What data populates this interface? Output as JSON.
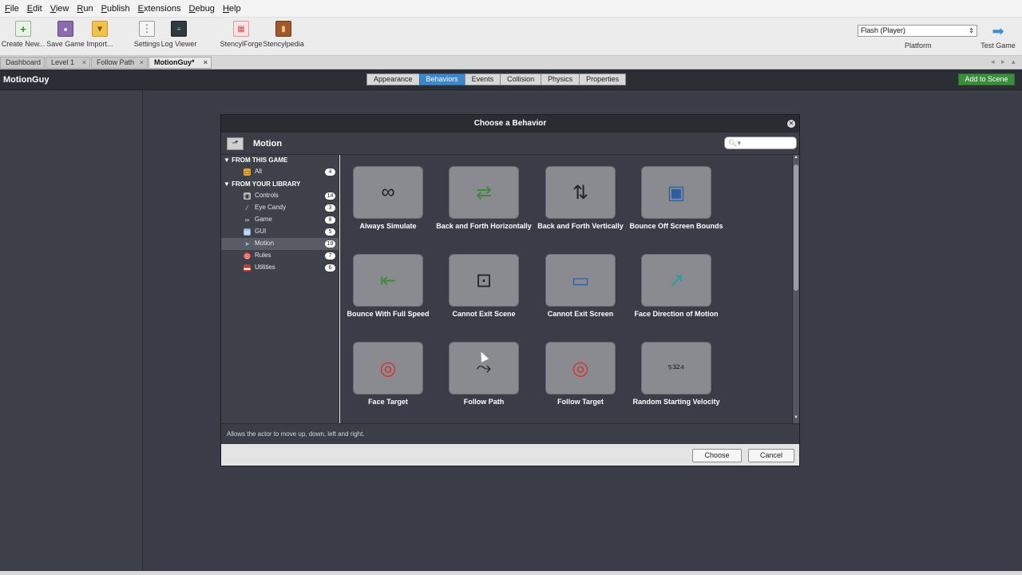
{
  "menu": [
    "File",
    "Edit",
    "View",
    "Run",
    "Publish",
    "Extensions",
    "Debug",
    "Help"
  ],
  "toolbar": {
    "create_new": "Create New...",
    "save_game": "Save Game",
    "import": "Import...",
    "settings": "Settings",
    "log_viewer": "Log Viewer",
    "stencylforge": "StencylForge",
    "stencylpedia": "Stencylpedia",
    "platform_value": "Flash (Player)",
    "platform_label": "Platform",
    "test_game": "Test Game"
  },
  "tabs": [
    {
      "label": "Dashboard"
    },
    {
      "label": "Level 1"
    },
    {
      "label": "Follow Path"
    },
    {
      "label": "MotionGuy*"
    }
  ],
  "actor": {
    "title": "MotionGuy",
    "segments": [
      "Appearance",
      "Behaviors",
      "Events",
      "Collision",
      "Physics",
      "Properties"
    ],
    "active_segment": "Behaviors",
    "add_to_scene": "Add to Scene"
  },
  "dialog": {
    "title": "Choose a Behavior",
    "section": "Motion",
    "sidebar": {
      "from_game": "FROM THIS GAME",
      "game_items": [
        {
          "label": "All",
          "count": "4"
        }
      ],
      "from_library": "FROM YOUR LIBRARY",
      "library_items": [
        {
          "label": "Controls",
          "count": "14"
        },
        {
          "label": "Eye Candy",
          "count": "3"
        },
        {
          "label": "Game",
          "count": "8"
        },
        {
          "label": "GUI",
          "count": "5"
        },
        {
          "label": "Motion",
          "count": "19"
        },
        {
          "label": "Rules",
          "count": "7"
        },
        {
          "label": "Utilities",
          "count": "6"
        }
      ],
      "active": "Motion"
    },
    "behaviors": [
      {
        "name": "Always Simulate"
      },
      {
        "name": "Back and Forth Horizontally"
      },
      {
        "name": "Back and Forth Vertically"
      },
      {
        "name": "Bounce Off Screen Bounds"
      },
      {
        "name": "Bounce With Full Speed"
      },
      {
        "name": "Cannot Exit Scene"
      },
      {
        "name": "Cannot Exit Screen"
      },
      {
        "name": "Face Direction of Motion"
      },
      {
        "name": "Face Target"
      },
      {
        "name": "Follow Path"
      },
      {
        "name": "Follow Target"
      },
      {
        "name": "Random Starting Velocity"
      }
    ],
    "description": "Allows the actor to move up, down, left and right.",
    "choose": "Choose",
    "cancel": "Cancel"
  }
}
